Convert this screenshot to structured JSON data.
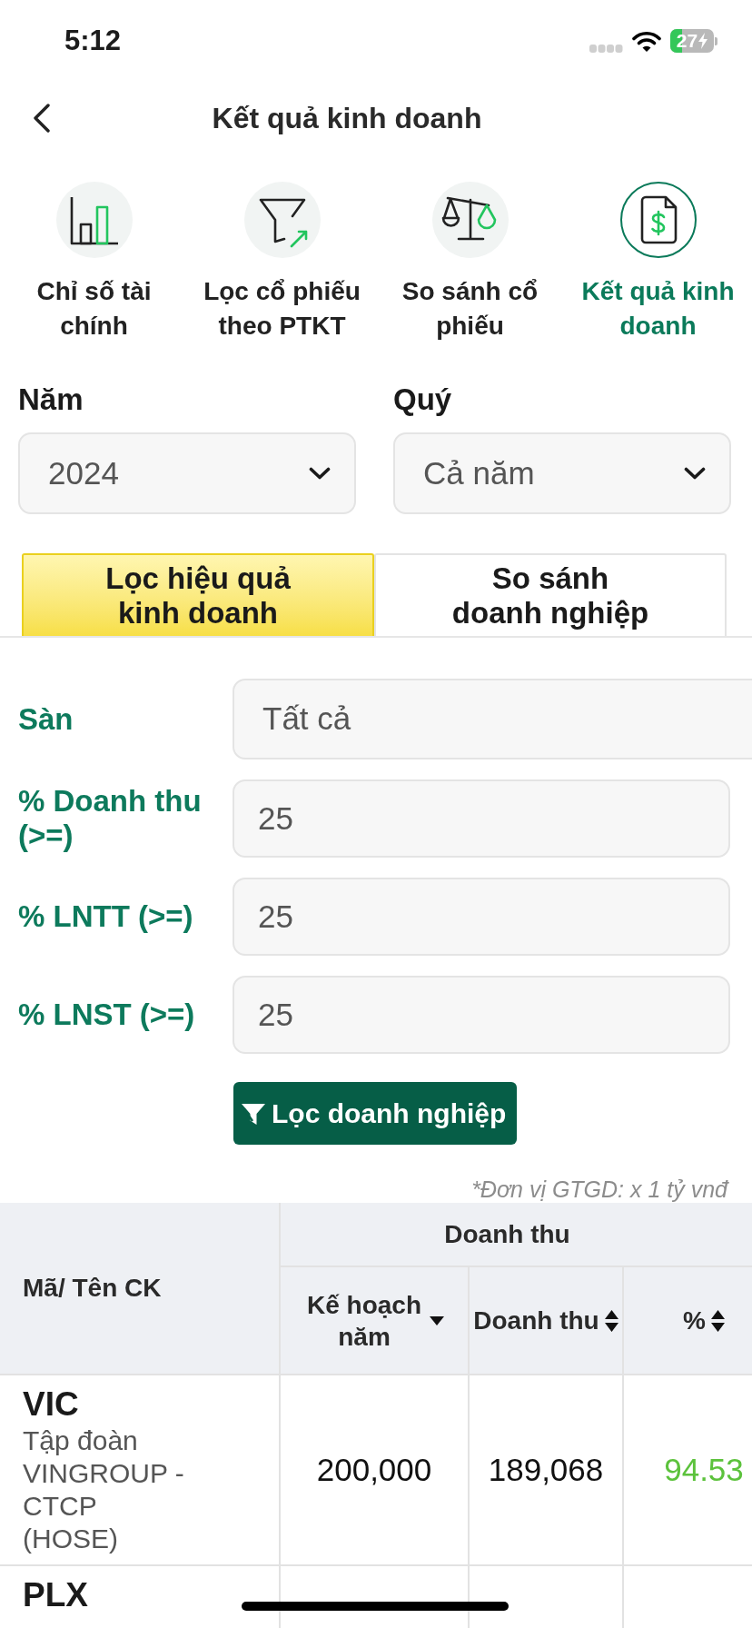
{
  "status_bar": {
    "time": "5:12",
    "battery": "27"
  },
  "header": {
    "title": "Kết quả kinh doanh"
  },
  "shortcuts": [
    {
      "kind": "chart",
      "label": "Chỉ số tài chính",
      "selected": false
    },
    {
      "kind": "filter",
      "label": "Lọc cổ phiếu theo PTKT",
      "selected": false
    },
    {
      "kind": "compare",
      "label": "So sánh cổ phiếu",
      "selected": false
    },
    {
      "kind": "report",
      "label": "Kết quả kinh doanh",
      "selected": true
    }
  ],
  "period": [
    {
      "label": "Năm",
      "value": "2024"
    },
    {
      "label": "Quý",
      "value": "Cả năm"
    }
  ],
  "tabs": [
    {
      "label": "Lọc hiệu quả\nkinh doanh",
      "selected": true
    },
    {
      "label": "So sánh\ndoanh nghiệp",
      "selected": false
    }
  ],
  "filters": [
    {
      "kind": "select",
      "label": "Sàn",
      "value": "Tất cả"
    },
    {
      "kind": "number",
      "label": "% Doanh thu (>=)",
      "value": "25"
    },
    {
      "kind": "number",
      "label": "% LNTT (>=)",
      "value": "25"
    },
    {
      "kind": "number",
      "label": "% LNST (>=)",
      "value": "25"
    }
  ],
  "filter_button": {
    "label": "Lọc doanh nghiệp"
  },
  "unit_note": "*Đơn vị GTGD: x 1 tỷ vnđ",
  "table": {
    "columns": [
      {
        "label": "Mã/ Tên CK"
      },
      {
        "label": "Doanh thu",
        "children": [
          {
            "label": "Kế hoạch năm",
            "sorted": true
          },
          {
            "label": "Doanh thu",
            "sorted": false
          },
          {
            "label": "%",
            "sorted": false
          }
        ]
      }
    ],
    "rows": [
      {
        "code": "VIC",
        "name": "Tập đoàn VINGROUP - CTCP",
        "exchange": "(HOSE)",
        "plan": "200,000",
        "revenue": "189,068",
        "percent": "94.53",
        "positive": true
      },
      {
        "code": "PLX"
      }
    ]
  }
}
